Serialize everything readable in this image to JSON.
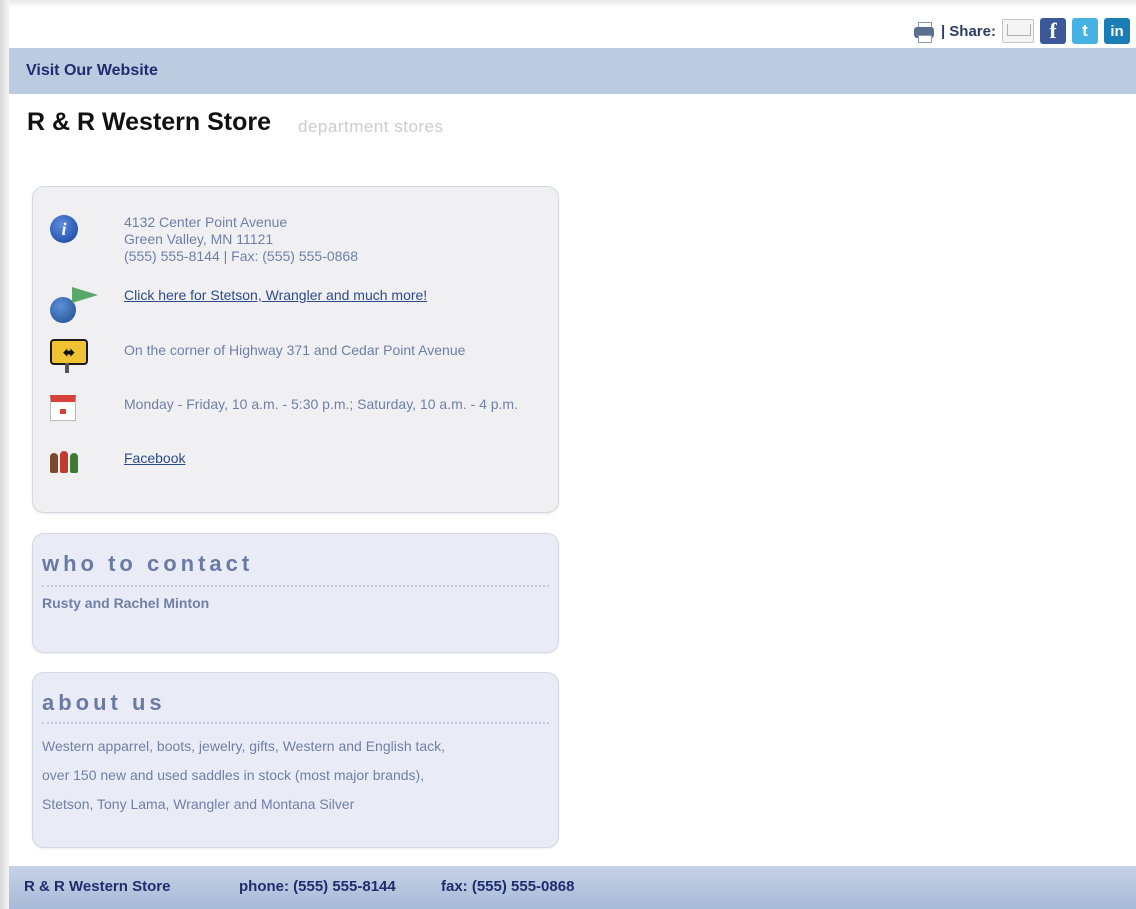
{
  "share": {
    "label": "| Share:",
    "icons": [
      "printer-icon",
      "email-icon",
      "facebook-icon",
      "twitter-icon",
      "linkedin-icon"
    ],
    "facebook_letter": "f",
    "twitter_letter": "t",
    "linkedin_letter": "in"
  },
  "nav": {
    "visit_label": "Visit Our Website"
  },
  "store": {
    "name": "R & R Western Store",
    "category": "department stores"
  },
  "info": {
    "address_line1": "4132 Center Point Avenue",
    "address_line2": "Green Valley, MN 11121",
    "phone_line": "(555) 555-8144 | Fax: (555) 555-0868",
    "website_link": "Click here for Stetson, Wrangler and much more!",
    "directions": "On the corner of Highway 371 and Cedar Point Avenue",
    "hours": "Monday - Friday, 10 a.m. - 5:30 p.m.; Saturday, 10 a.m. - 4 p.m.",
    "facebook_link": "Facebook",
    "info_icon_letter": "i",
    "sign_arrows": "⬌"
  },
  "contact": {
    "title": "who to contact",
    "name": "Rusty and Rachel Minton"
  },
  "about": {
    "title": "about us",
    "lines": [
      "Western apparrel, boots, jewelry, gifts, Western and English tack,",
      "over 150 new and used saddles in stock (most major brands),",
      "Stetson, Tony Lama, Wrangler and Montana Silver"
    ]
  },
  "footer": {
    "store": "R & R Western Store",
    "phone": "phone: (555) 555-8144",
    "fax": "fax: (555) 555-0868"
  },
  "colors": {
    "nav_bar": "#bccbe0",
    "link": "#2d4b8b",
    "facebook": "#3b5998",
    "twitter": "#46b1e3",
    "linkedin": "#1a7db5"
  }
}
